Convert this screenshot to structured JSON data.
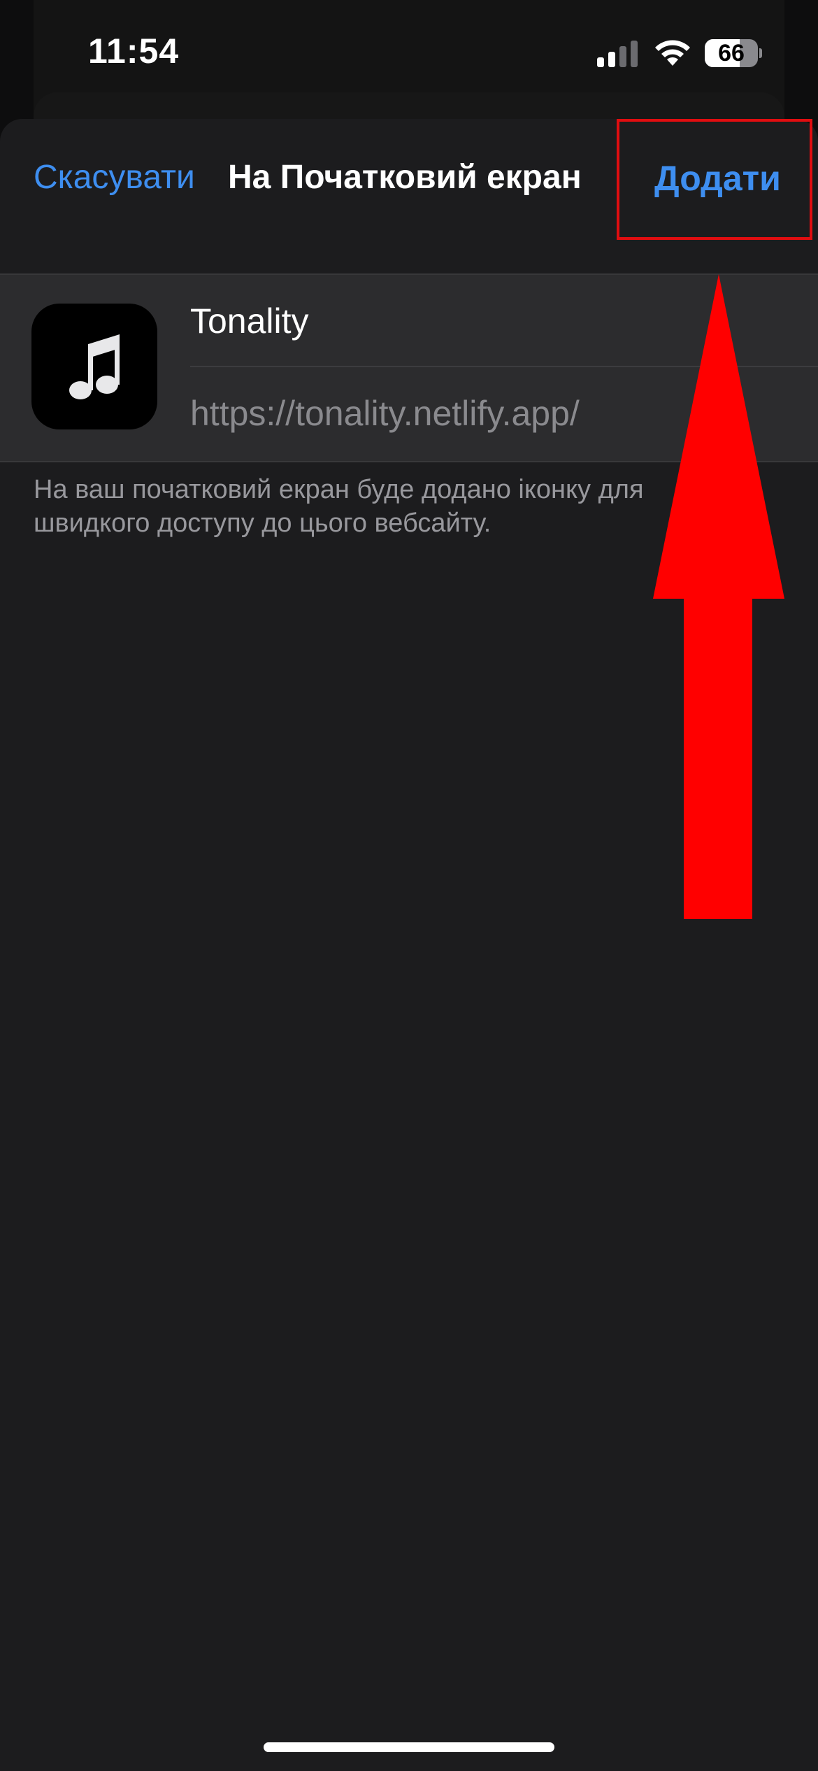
{
  "status_bar": {
    "time": "11:54",
    "battery_level": "66",
    "icons": [
      "cellular-signal-icon",
      "wifi-icon",
      "battery-icon"
    ]
  },
  "nav": {
    "cancel_label": "Скасувати",
    "title": "На Початковий екран",
    "add_label": "Додати"
  },
  "app": {
    "icon": "music-note-icon",
    "name": "Tonality",
    "url": "https://tonality.netlify.app/"
  },
  "footnote": "На ваш початковий екран буде додано іконку для швидкого доступу до цього вебсайту.",
  "annotation": {
    "highlight_color": "#e00d10",
    "arrow_color": "#ff0000"
  },
  "colors": {
    "accent": "#3e8ef0",
    "sheet_bg": "#1c1c1e",
    "card_bg": "#2c2c2e"
  }
}
